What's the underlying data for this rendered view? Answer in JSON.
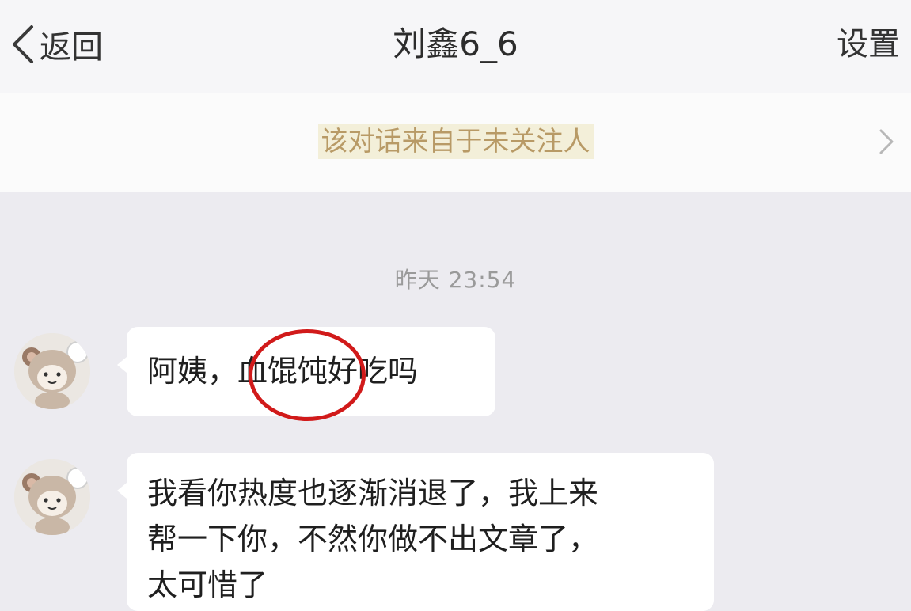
{
  "navbar": {
    "back_label": "返回",
    "title": "刘鑫6_6",
    "settings_label": "设置"
  },
  "notice": {
    "text": "该对话来自于未关注人",
    "chevron_icon": "chevron-right-icon"
  },
  "chat": {
    "timestamp": "昨天 23:54",
    "messages": [
      {
        "sender": "incoming",
        "avatar_icon": "bear-avatar",
        "text": "阿姨，血馄饨好吃吗",
        "annotation": "red-circle-highlight"
      },
      {
        "sender": "incoming",
        "avatar_icon": "bear-avatar",
        "text": "我看你热度也逐渐消退了，我上来\n帮一下你，不然你做不出文章了，\n太可惜了"
      }
    ]
  },
  "colors": {
    "background": "#ecebf0",
    "navbar": "#f6f6f8",
    "notice_text": "#b89a66",
    "bubble": "#ffffff",
    "annotation": "#d11a1a"
  }
}
